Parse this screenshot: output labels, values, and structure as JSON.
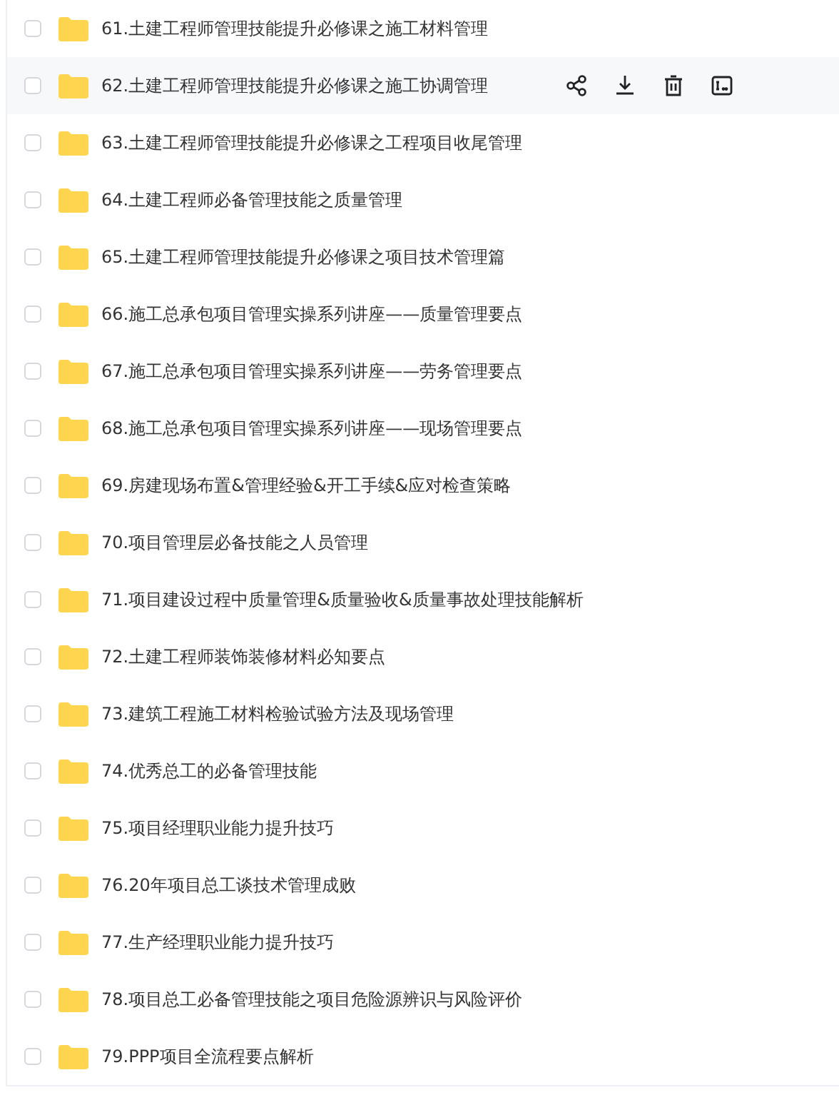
{
  "files": [
    {
      "name": "61.土建工程师管理技能提升必修课之施工材料管理",
      "checked": false,
      "highlighted": false
    },
    {
      "name": "62.土建工程师管理技能提升必修课之施工协调管理",
      "checked": false,
      "highlighted": true
    },
    {
      "name": "63.土建工程师管理技能提升必修课之工程项目收尾管理",
      "checked": false,
      "highlighted": false
    },
    {
      "name": "64.土建工程师必备管理技能之质量管理",
      "checked": false,
      "highlighted": false
    },
    {
      "name": "65.土建工程师管理技能提升必修课之项目技术管理篇",
      "checked": false,
      "highlighted": false
    },
    {
      "name": "66.施工总承包项目管理实操系列讲座——质量管理要点",
      "checked": false,
      "highlighted": false
    },
    {
      "name": "67.施工总承包项目管理实操系列讲座——劳务管理要点",
      "checked": false,
      "highlighted": false
    },
    {
      "name": "68.施工总承包项目管理实操系列讲座——现场管理要点",
      "checked": false,
      "highlighted": false
    },
    {
      "name": "69.房建现场布置&管理经验&开工手续&应对检查策略",
      "checked": false,
      "highlighted": false
    },
    {
      "name": "70.项目管理层必备技能之人员管理",
      "checked": false,
      "highlighted": false
    },
    {
      "name": "71.项目建设过程中质量管理&质量验收&质量事故处理技能解析",
      "checked": false,
      "highlighted": false
    },
    {
      "name": "72.土建工程师装饰装修材料必知要点",
      "checked": false,
      "highlighted": false
    },
    {
      "name": "73.建筑工程施工材料检验试验方法及现场管理",
      "checked": false,
      "highlighted": false
    },
    {
      "name": "74.优秀总工的必备管理技能",
      "checked": false,
      "highlighted": false
    },
    {
      "name": "75.项目经理职业能力提升技巧",
      "checked": false,
      "highlighted": false
    },
    {
      "name": "76.20年项目总工谈技术管理成败",
      "checked": false,
      "highlighted": false
    },
    {
      "name": "77.生产经理职业能力提升技巧",
      "checked": false,
      "highlighted": false
    },
    {
      "name": "78.项目总工必备管理技能之项目危险源辨识与风险评价",
      "checked": false,
      "highlighted": false
    },
    {
      "name": "79.PPP项目全流程要点解析",
      "checked": false,
      "highlighted": false
    }
  ]
}
